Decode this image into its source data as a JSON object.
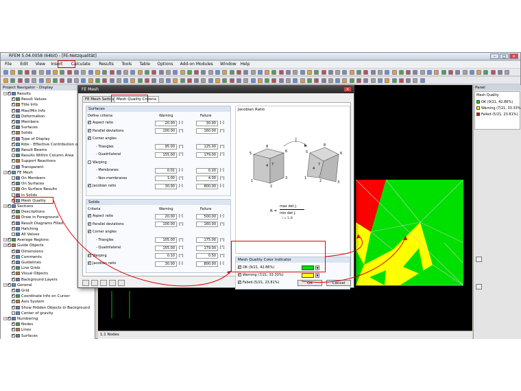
{
  "window": {
    "title": "RFEM 5.04.0058 (64bit) - [FE-Netzqualität]"
  },
  "menu": [
    "File",
    "Edit",
    "View",
    "Insert",
    "Calculate",
    "Results",
    "Tools",
    "Table",
    "Options",
    "Add-on Modules",
    "Window",
    "Help"
  ],
  "navigator": {
    "header": "Project Navigator - Display",
    "items": [
      {
        "label": "Results",
        "indent": 0,
        "checked": true
      },
      {
        "label": "Result Values",
        "indent": 1,
        "checked": true
      },
      {
        "label": "Title Info",
        "indent": 1,
        "checked": true
      },
      {
        "label": "Max/Min Info",
        "indent": 1,
        "checked": true
      },
      {
        "label": "Deformation",
        "indent": 1,
        "checked": true
      },
      {
        "label": "Members",
        "indent": 1,
        "checked": true
      },
      {
        "label": "Surfaces",
        "indent": 1,
        "checked": true
      },
      {
        "label": "Solids",
        "indent": 1,
        "checked": true
      },
      {
        "label": "Type of Display",
        "indent": 1,
        "checked": true
      },
      {
        "label": "Ribs - Effective Contribution on",
        "indent": 1,
        "checked": true
      },
      {
        "label": "Result Beams",
        "indent": 1,
        "checked": true
      },
      {
        "label": "Results Within Column Area",
        "indent": 1,
        "checked": false
      },
      {
        "label": "Support Reactions",
        "indent": 1,
        "checked": true
      },
      {
        "label": "Transparent",
        "indent": 1,
        "checked": false
      },
      {
        "label": "FE Mesh",
        "indent": 0,
        "checked": true
      },
      {
        "label": "On Members",
        "indent": 1,
        "checked": false
      },
      {
        "label": "On Surfaces",
        "indent": 1,
        "checked": true
      },
      {
        "label": "On Surface Results",
        "indent": 1,
        "checked": false
      },
      {
        "label": "In Solids",
        "indent": 1,
        "checked": false
      },
      {
        "label": "Mesh Quality",
        "indent": 1,
        "checked": true
      },
      {
        "label": "Sections",
        "indent": 0,
        "checked": true
      },
      {
        "label": "Descriptions",
        "indent": 1,
        "checked": true
      },
      {
        "label": "Draw in Foreground",
        "indent": 1,
        "checked": true
      },
      {
        "label": "Result Diagrams Filled",
        "indent": 1,
        "checked": true
      },
      {
        "label": "Hatching",
        "indent": 1,
        "checked": true
      },
      {
        "label": "All Values",
        "indent": 1,
        "checked": false
      },
      {
        "label": "Average Regions",
        "indent": 0,
        "checked": true
      },
      {
        "label": "Guide Objects",
        "indent": 0,
        "checked": true
      },
      {
        "label": "Dimensions",
        "indent": 1,
        "checked": true
      },
      {
        "label": "Comments",
        "indent": 1,
        "checked": true
      },
      {
        "label": "Guidelines",
        "indent": 1,
        "checked": true
      },
      {
        "label": "Line Grids",
        "indent": 1,
        "checked": true
      },
      {
        "label": "Visual Objects",
        "indent": 1,
        "checked": true
      },
      {
        "label": "Background Layers",
        "indent": 1,
        "checked": true
      },
      {
        "label": "General",
        "indent": 0,
        "checked": true
      },
      {
        "label": "Grid",
        "indent": 1,
        "checked": true
      },
      {
        "label": "Coordinate Info on Cursor",
        "indent": 1,
        "checked": true
      },
      {
        "label": "Axis System",
        "indent": 1,
        "checked": true
      },
      {
        "label": "Show Hidden Objects in Background",
        "indent": 1,
        "checked": true
      },
      {
        "label": "Center of gravity",
        "indent": 1,
        "checked": false
      },
      {
        "label": "Numbering",
        "indent": 0,
        "checked": true
      },
      {
        "label": "Nodes",
        "indent": 1,
        "checked": true
      },
      {
        "label": "Lines",
        "indent": 1,
        "checked": true
      },
      {
        "label": "Surfaces",
        "indent": 1,
        "checked": true
      }
    ]
  },
  "viewport": {
    "status_label": "1.1 Nodes"
  },
  "panel": {
    "header": "Panel",
    "legend_title": "Mesh Quality",
    "items": [
      {
        "label": "OK (9/21, 42.86%)",
        "color": "#00e000"
      },
      {
        "label": "Warning (7/21, 33.33%)",
        "color": "#ffff00"
      },
      {
        "label": "Failed (5/21, 23.81%)",
        "color": "#ff0000"
      }
    ]
  },
  "dialog": {
    "title": "FE Mesh",
    "tabs": [
      "FE Mesh Settings",
      "Mesh Quality Criteria"
    ],
    "surfaces": {
      "header": "Surfaces",
      "criteria_label": "Define criteria:",
      "warning_label": "Warning",
      "failure_label": "Failure",
      "rows": [
        {
          "label": "Aspect ratio",
          "cb": true,
          "warning": "20.00",
          "failure": "30.00",
          "unit": "[-]"
        },
        {
          "label": "Parallel deviations",
          "cb": true,
          "warning": "100.00",
          "failure": "160.00",
          "unit": "[°]"
        },
        {
          "label": "Corner angles",
          "cb": true
        },
        {
          "label": "- Triangles",
          "warning": "95.00",
          "failure": "125.00",
          "unit": "[°]"
        },
        {
          "label": "- Quadrilateral",
          "warning": "155.00",
          "failure": "179.00",
          "unit": "[°]"
        },
        {
          "label": "Warping",
          "cb": false
        },
        {
          "label": "- Membranes",
          "warning": "0.01",
          "failure": "0.20",
          "unit": "[-]"
        },
        {
          "label": "- Non-membranes",
          "warning": "1.00",
          "failure": "4.00",
          "unit": "[°]"
        },
        {
          "label": "Jacobian ratio",
          "cb": true,
          "warning": "30.00",
          "failure": "800.00",
          "unit": "[-]"
        }
      ]
    },
    "solids": {
      "header": "Solids",
      "criteria_label": "Criteria",
      "warning_label": "Warning",
      "failure_label": "Failure",
      "rows": [
        {
          "label": "Aspect ratio",
          "cb": true,
          "warning": "20.00",
          "failure": "500.00",
          "unit": "[-]"
        },
        {
          "label": "Parallel deviations",
          "cb": true,
          "warning": "100.00",
          "failure": "160.00",
          "unit": "[°]"
        },
        {
          "label": "Corner angles",
          "cb": true
        },
        {
          "label": "- Triangles",
          "warning": "105.00",
          "failure": "175.00",
          "unit": "[°]"
        },
        {
          "label": "- Quadrilateral",
          "warning": "155.00",
          "failure": "179.00",
          "unit": "[°]"
        },
        {
          "label": "Warping",
          "cb": true,
          "warning": "0.10",
          "failure": "0.50",
          "unit": "[°]"
        },
        {
          "label": "Jacobian ratio",
          "cb": true,
          "warning": "30.00",
          "failure": "800.00",
          "unit": "[-]"
        }
      ]
    },
    "jacobian": {
      "title": "Jacobian Ratio",
      "formula_left": "R =",
      "formula_num": "max det Jᵢ",
      "formula_den": "min det Jᵢ",
      "formula_range": "i = 1..8",
      "cube_labels_left": [
        "5",
        "8",
        "6",
        "4",
        "7",
        "1",
        "2",
        "3"
      ],
      "cube_labels_right": [
        "5",
        "8",
        "6",
        "7",
        "4",
        "1",
        "2",
        "3"
      ],
      "arrow_label": "J"
    },
    "color_indicator": {
      "header": "Mesh Quality Color Indicator",
      "items": [
        {
          "label": "OK (9/21, 42.86%)",
          "color": "#00e000"
        },
        {
          "label": "Warning (7/21, 33.33%)",
          "color": "#ffff00"
        },
        {
          "label": "Failed (5/21, 23.81%)",
          "color": "#ff0000"
        }
      ]
    },
    "ok_label": "OK",
    "cancel_label": "Cancel"
  }
}
